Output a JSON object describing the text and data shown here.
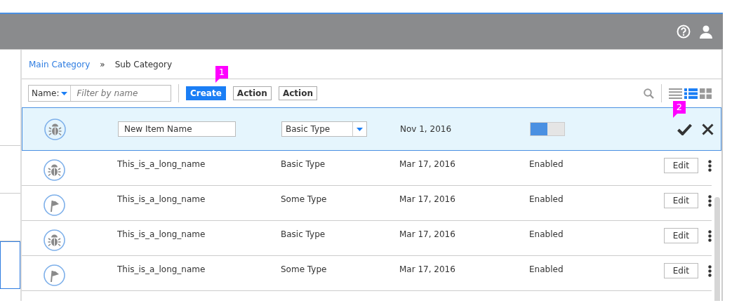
{
  "left_list": [
    {
      "selected": false
    },
    {
      "selected": false
    },
    {
      "selected": false
    },
    {
      "selected": true
    }
  ],
  "breadcrumb": {
    "items": [
      "Main Category",
      "Sub Category"
    ],
    "separator": "»"
  },
  "toolbar": {
    "filter": {
      "field_label": "Name:",
      "placeholder": "Filter by name"
    },
    "buttons": [
      {
        "label": "Create",
        "kind": "primary"
      },
      {
        "label": "Action",
        "kind": "default"
      },
      {
        "label": "Action",
        "kind": "default"
      }
    ],
    "views": [
      {
        "kind": "list",
        "selected": false
      },
      {
        "kind": "details",
        "selected": true
      },
      {
        "kind": "grid",
        "selected": false
      }
    ]
  },
  "annotations": [
    {
      "label": "1"
    },
    {
      "label": "2"
    }
  ],
  "edit_row": {
    "kind": "bug",
    "name_value": "New Item Name",
    "type_value": "Basic Type",
    "date": "Nov 1, 2016",
    "enabled": true
  },
  "rows": [
    {
      "kind": "bug",
      "name": "This_is_a_long_name",
      "type": "Basic Type",
      "date": "Mar 17, 2016",
      "status": "Enabled",
      "action": "Edit"
    },
    {
      "kind": "flag",
      "name": "This_is_a_long_name",
      "type": "Some Type",
      "date": "Mar 17, 2016",
      "status": "Enabled",
      "action": "Edit"
    },
    {
      "kind": "bug",
      "name": "This_is_a_long_name",
      "type": "Basic Type",
      "date": "Mar 17, 2016",
      "status": "Enabled",
      "action": "Edit"
    },
    {
      "kind": "flag",
      "name": "This_is_a_long_name",
      "type": "Some Type",
      "date": "Mar 17, 2016",
      "status": "Enabled",
      "action": "Edit"
    }
  ]
}
